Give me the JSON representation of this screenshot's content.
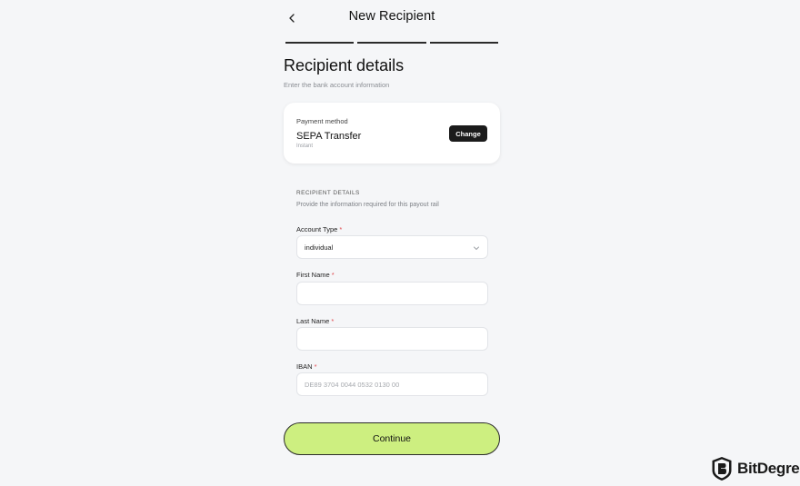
{
  "header": {
    "title": "New Recipient",
    "back_icon": "chevron-left-icon"
  },
  "progress": {
    "steps_total": 3
  },
  "page": {
    "heading": "Recipient details",
    "subheading": "Enter the bank account information"
  },
  "payment_method": {
    "label": "Payment method",
    "value": "SEPA Transfer",
    "note": "Instant",
    "change_label": "Change"
  },
  "recipient_section": {
    "title": "RECIPIENT DETAILS",
    "subtitle": "Provide the information required for this payout rail"
  },
  "fields": {
    "account_type": {
      "label": "Account Type",
      "required_mark": "*",
      "value": "individual"
    },
    "first_name": {
      "label": "First Name",
      "required_mark": "*",
      "value": "",
      "placeholder": ""
    },
    "last_name": {
      "label": "Last Name",
      "required_mark": "*",
      "value": "",
      "placeholder": ""
    },
    "iban": {
      "label": "IBAN",
      "required_mark": "*",
      "value": "",
      "placeholder": "DE89 3704 0044 0532 0130 00"
    }
  },
  "continue_label": "Continue",
  "watermark": {
    "text": "BitDegree"
  },
  "colors": {
    "background": "#f5f6f8",
    "accent_button": "#cdef80",
    "dark_button": "#1b1b1b",
    "required": "#e0474c"
  }
}
